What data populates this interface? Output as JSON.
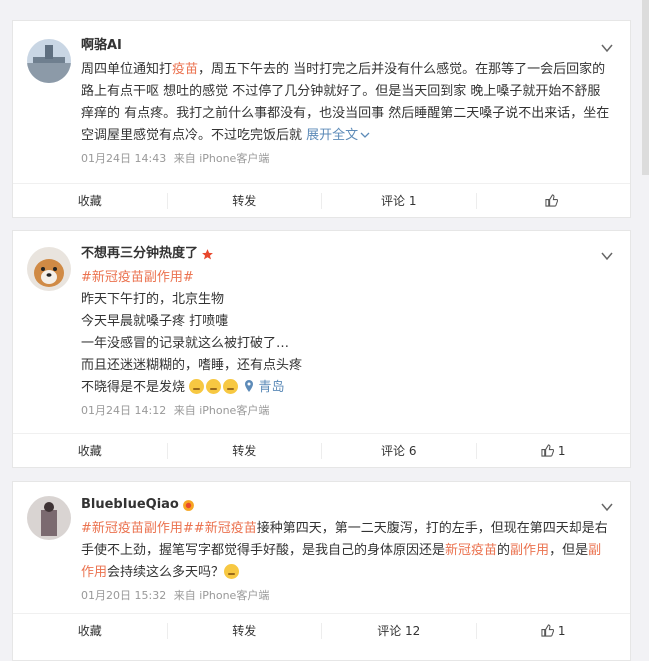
{
  "posts": [
    {
      "username": "啊骆AI",
      "text_parts": [
        {
          "t": "周四单位通知打",
          "c": ""
        },
        {
          "t": "疫苗",
          "c": "lnk"
        },
        {
          "t": "，周五下午去的 当时打完之后并没有什么感觉。在那等了一会后回家的路上有点干呕 想吐的感觉 不过停了几分钟就好了。但是当天回到家 晚上嗓子就开始不舒服 痒痒的 有点疼。我打之前什么事都没有，也没当回事 然后睡醒第二天嗓子说不出来话，坐在空调屋里感觉有点冷。不过吃完饭后就 ",
          "c": ""
        },
        {
          "t": "展开全文",
          "c": "blue"
        }
      ],
      "date": "01月24日 14:43",
      "source": "来自 iPhone客户端",
      "collect": "收藏",
      "repost": "转发",
      "comment": "评论 1",
      "like": ""
    },
    {
      "username": "不想再三分钟热度了",
      "hashtag": "#新冠疫苗副作用#",
      "lines": [
        "昨天下午打的，北京生物",
        "今天早晨就嗓子疼 打喷嚏",
        "一年没感冒的记录就这么被打破了…",
        "而且还迷迷糊糊的，嗜睡，还有点头疼",
        "不晓得是不是发烧"
      ],
      "location": "青岛",
      "date": "01月24日 14:12",
      "source": "来自 iPhone客户端",
      "collect": "收藏",
      "repost": "转发",
      "comment": "评论 6",
      "like": "1"
    },
    {
      "username": "BluebIueQiao",
      "text_parts": [
        {
          "t": "#新冠疫苗副作用#",
          "c": "lnk"
        },
        {
          "t": "#新冠疫苗",
          "c": "lnk"
        },
        {
          "t": "接种第四天，第一二天腹泻，打的左手，但现在第四天却是右手使不上劲，握笔写字都觉得手好酸，是我自己的身体原因还是",
          "c": ""
        },
        {
          "t": "新冠疫苗",
          "c": "lnk"
        },
        {
          "t": "的",
          "c": ""
        },
        {
          "t": "副作用",
          "c": "lnk"
        },
        {
          "t": "，但是",
          "c": ""
        },
        {
          "t": "副作用",
          "c": "lnk"
        },
        {
          "t": "会持续这么多天吗？",
          "c": ""
        }
      ],
      "date": "01月20日 15:32",
      "source": "来自 iPhone客户端",
      "collect": "收藏",
      "repost": "转发",
      "comment": "评论 12",
      "like": "1"
    }
  ],
  "colors": {
    "link": "#eb7350",
    "blue": "#5d8bb8",
    "text": "#333333",
    "meta": "#999999"
  }
}
